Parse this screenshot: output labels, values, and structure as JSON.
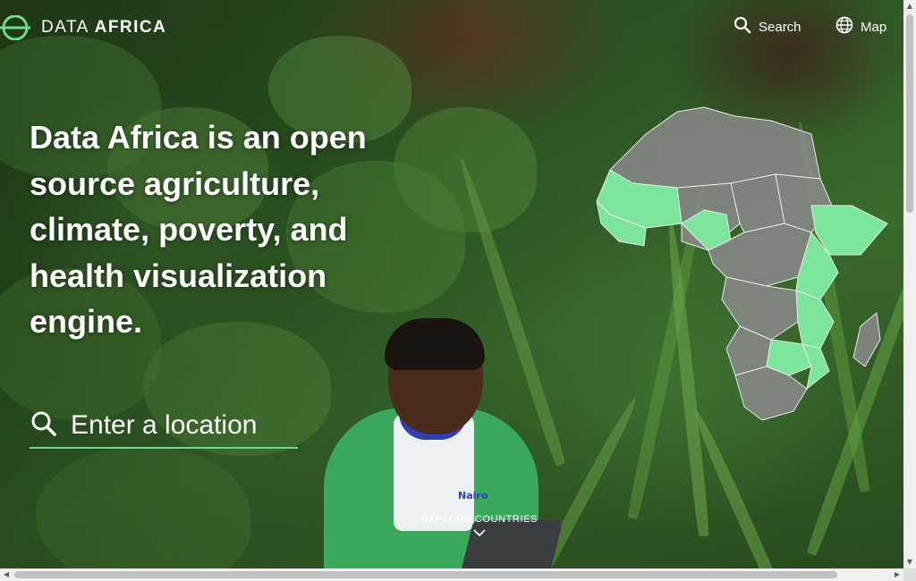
{
  "site": {
    "logo_plain": "DATA",
    "logo_bold": "AFRICA"
  },
  "nav": {
    "search_label": "Search",
    "search_icon": "search-icon",
    "map_label": "Map",
    "map_icon": "globe-icon"
  },
  "hero": {
    "headline_lines": [
      "Data Africa is an open",
      "source agriculture,",
      "climate, poverty, and",
      "health visualization",
      "engine."
    ],
    "search_placeholder": "Enter a location",
    "explore_label": "EXPLORE COUNTRIES",
    "shirt_text": "Nairo"
  },
  "colors": {
    "accent": "#6bdc8f",
    "map_highlight": "#7be69c",
    "map_base": "#8c8c8c"
  }
}
